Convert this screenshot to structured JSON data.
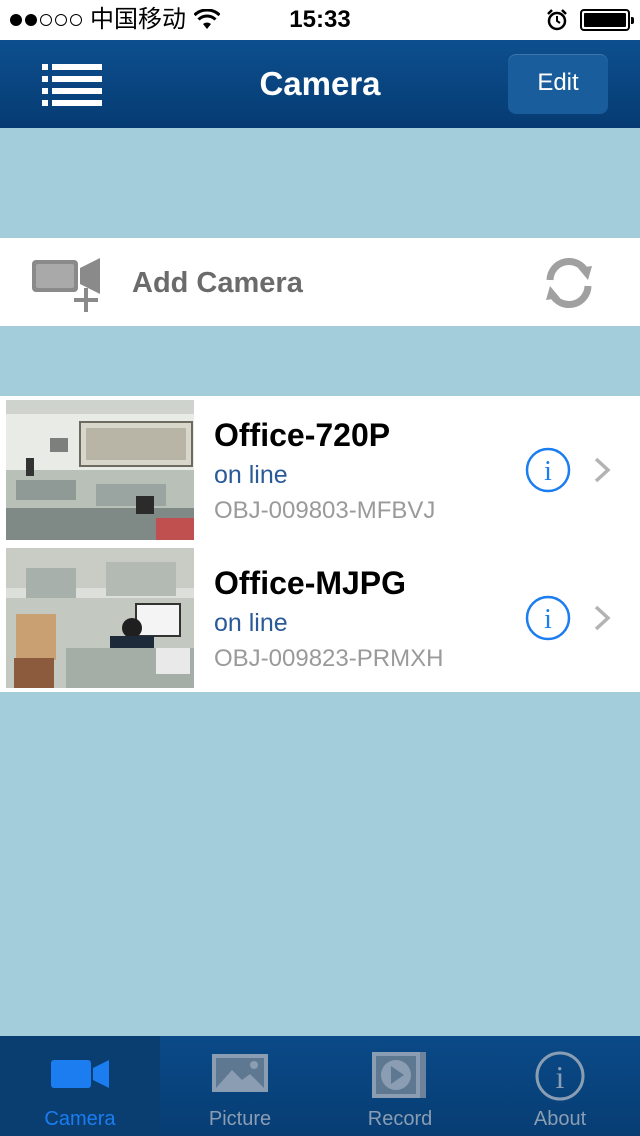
{
  "status_bar": {
    "carrier": "中国移动",
    "time": "15:33"
  },
  "nav": {
    "title": "Camera",
    "edit_label": "Edit",
    "menu_icon": "list-icon"
  },
  "add_camera": {
    "label": "Add Camera",
    "icon": "add-camera-icon",
    "refresh_icon": "refresh-icon"
  },
  "cameras": [
    {
      "name": "Office-720P",
      "status": "on line",
      "id": "OBJ-009803-MFBVJ"
    },
    {
      "name": "Office-MJPG",
      "status": "on line",
      "id": "OBJ-009823-PRMXH"
    }
  ],
  "tabs": [
    {
      "label": "Camera",
      "icon": "video-camera-icon",
      "active": true
    },
    {
      "label": "Picture",
      "icon": "picture-icon",
      "active": false
    },
    {
      "label": "Record",
      "icon": "record-play-icon",
      "active": false
    },
    {
      "label": "About",
      "icon": "info-icon",
      "active": false
    }
  ],
  "colors": {
    "nav_bar": "#0d4f8f",
    "background": "#a4cddb",
    "accent": "#1b7df0",
    "status_text": "#2a5a98"
  }
}
